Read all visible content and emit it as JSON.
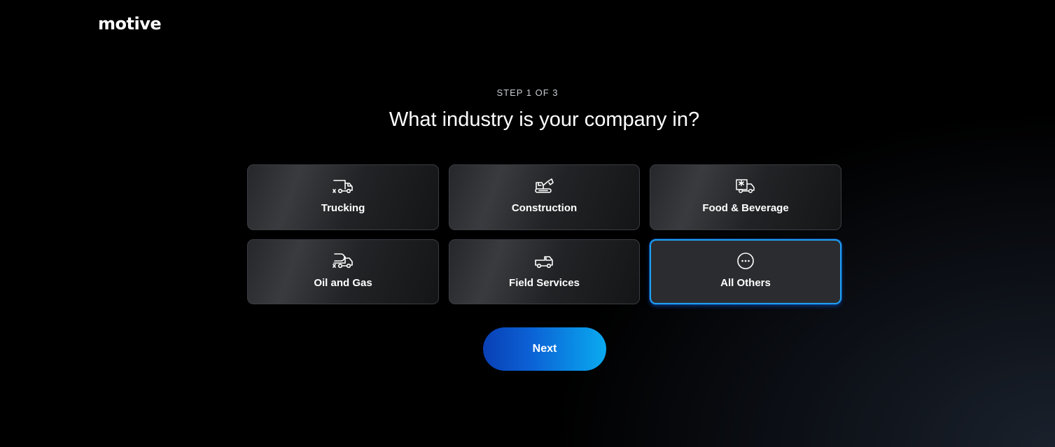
{
  "brand": {
    "logo_text": "motive"
  },
  "wizard": {
    "step_label": "STEP 1 OF 3",
    "question": "What industry is your company in?"
  },
  "industries": [
    {
      "label": "Trucking",
      "icon": "truck-icon",
      "selected": false
    },
    {
      "label": "Construction",
      "icon": "excavator-icon",
      "selected": false
    },
    {
      "label": "Food & Beverage",
      "icon": "refrigerated-truck-icon",
      "selected": false
    },
    {
      "label": "Oil and Gas",
      "icon": "tanker-truck-icon",
      "selected": false
    },
    {
      "label": "Field Services",
      "icon": "pickup-truck-icon",
      "selected": false
    },
    {
      "label": "All Others",
      "icon": "more-dots-icon",
      "selected": true
    }
  ],
  "actions": {
    "next_label": "Next"
  },
  "colors": {
    "accent_start": "#0a3fb5",
    "accent_end": "#0aaaf0",
    "selected_border": "#1ea0f2",
    "card_bg": "#2b2c2f",
    "page_bg": "#000000"
  }
}
